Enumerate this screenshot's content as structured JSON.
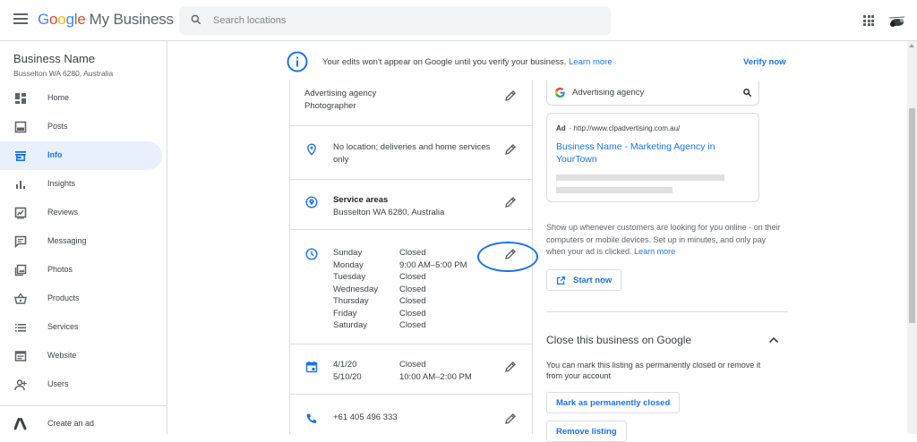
{
  "app": {
    "logo": {
      "g1": "G",
      "g2": "o",
      "g3": "o",
      "g4": "g",
      "g5": "l",
      "g6": "e",
      "suffix": "My Business"
    },
    "search": {
      "placeholder": "Search locations"
    }
  },
  "sidebar": {
    "business_name": "Business Name",
    "business_address": "Busselton WA 6280, Australia",
    "items": [
      {
        "label": "Home",
        "icon": "dashboard-icon"
      },
      {
        "label": "Posts",
        "icon": "posts-icon"
      },
      {
        "label": "Info",
        "icon": "store-icon",
        "active": true
      },
      {
        "label": "Insights",
        "icon": "bar-chart-icon"
      },
      {
        "label": "Reviews",
        "icon": "reviews-icon"
      },
      {
        "label": "Messaging",
        "icon": "message-icon"
      },
      {
        "label": "Photos",
        "icon": "photos-icon"
      },
      {
        "label": "Products",
        "icon": "basket-icon"
      },
      {
        "label": "Services",
        "icon": "list-icon"
      },
      {
        "label": "Website",
        "icon": "web-icon"
      },
      {
        "label": "Users",
        "icon": "add-user-icon"
      },
      {
        "label": "Create an ad",
        "icon": "google-ads-icon"
      }
    ]
  },
  "banner": {
    "message": "Your edits won't appear on Google until you verify your business.",
    "learn_more": "Learn more",
    "verify": "Verify now"
  },
  "info": {
    "categories": [
      "Advertising agency",
      "Photographer"
    ],
    "location": "No location; deliveries and home services only",
    "service_areas_title": "Service areas",
    "service_areas_value": "Busselton WA 6280, Australia",
    "hours": [
      {
        "day": "Sunday",
        "value": "Closed"
      },
      {
        "day": "Monday",
        "value": "9:00 AM–5:00 PM"
      },
      {
        "day": "Tuesday",
        "value": "Closed"
      },
      {
        "day": "Wednesday",
        "value": "Closed"
      },
      {
        "day": "Thursday",
        "value": "Closed"
      },
      {
        "day": "Friday",
        "value": "Closed"
      },
      {
        "day": "Saturday",
        "value": "Closed"
      }
    ],
    "special_hours": [
      {
        "date": "4/1/20",
        "value": "Closed"
      },
      {
        "date": "5/10/20",
        "value": "10:00 AM–2:00 PM"
      }
    ],
    "phone": "+61 405 496 333"
  },
  "ad_preview": {
    "query": "Advertising agency",
    "ad_label": "Ad",
    "ad_url": "· http://www.clpadvertising.com.au/",
    "ad_title": "Business Name - Marketing Agency in YourTown",
    "promo": "Show up whenever customers are looking for you online - on their computers or mobile devices. Set up in minutes, and only pay when your ad is clicked.",
    "promo_link": "Learn more",
    "start_now": "Start now"
  },
  "close_section": {
    "title": "Close this business on Google",
    "description": "You can mark this listing as permanently closed or remove it from your account",
    "mark_closed": "Mark as permanently closed",
    "remove": "Remove listing"
  },
  "colors": {
    "accent": "#1a73e8",
    "active_bg": "#e8f0fe",
    "divider": "#dadce0"
  }
}
